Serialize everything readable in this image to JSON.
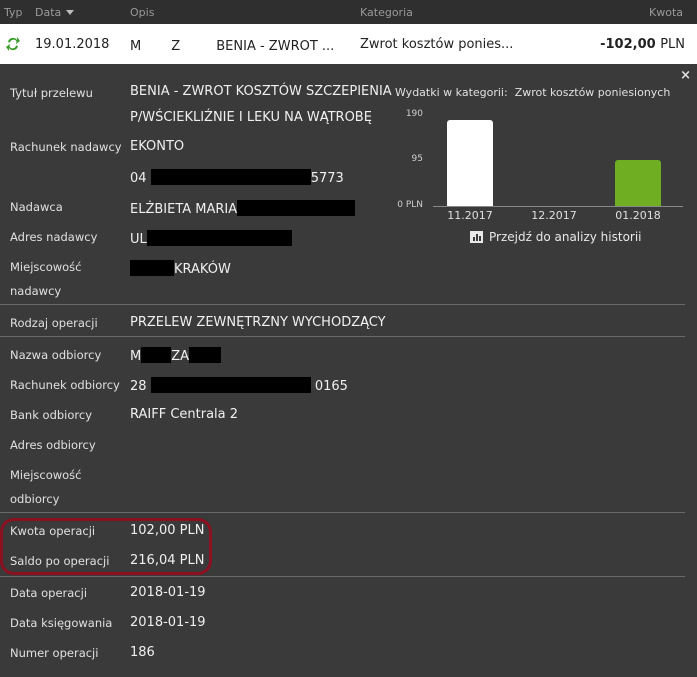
{
  "table": {
    "headers": {
      "typ": "Typ",
      "data": "Data",
      "opis": "Opis",
      "kategoria": "Kategoria",
      "kwota": "Kwota"
    },
    "row": {
      "date": "19.01.2018",
      "desc_prefix": "M",
      "desc_mid": "Z",
      "desc_suffix": "BENIA - ZWROT ...",
      "category": "Zwrot kosztów ponies...",
      "amount": "-102,00",
      "currency": "PLN"
    }
  },
  "details": {
    "close": "×",
    "tytul": {
      "label": "Tytuł przelewu",
      "line1": "BENIA - ZWROT KOSZTÓW SZCZEPIENIA",
      "line2": "P/WŚCIEKLIŹNIE I LEKU NA WĄTROBĘ"
    },
    "rachunek_nadawcy": {
      "label": "Rachunek nadawcy",
      "line1": "EKONTO",
      "prefix": "04",
      "suffix": "5773"
    },
    "nadawca": {
      "label": "Nadawca",
      "value": "ELŻBIETA MARIA"
    },
    "adres_nadawcy": {
      "label": "Adres nadawcy",
      "value": "UL"
    },
    "miejscowosc_nadawcy": {
      "label1": "Miejscowość",
      "label2": "nadawcy",
      "value": "KRAKÓW"
    },
    "rodzaj": {
      "label": "Rodzaj operacji",
      "value": "PRZELEW ZEWNĘTRZNY WYCHODZĄCY"
    },
    "nazwa_odbiorcy": {
      "label": "Nazwa odbiorcy",
      "prefix": "M",
      "mid": "ZA"
    },
    "rachunek_odbiorcy": {
      "label": "Rachunek odbiorcy",
      "prefix": "28",
      "suffix": "0165"
    },
    "bank_odbiorcy": {
      "label": "Bank odbiorcy",
      "value": "RAIFF Centrala 2"
    },
    "adres_odbiorcy": {
      "label": "Adres odbiorcy"
    },
    "miejscowosc_odbiorcy": {
      "label1": "Miejscowość",
      "label2": "odbiorcy"
    },
    "kwota": {
      "label": "Kwota operacji",
      "value": "102,00 PLN"
    },
    "saldo": {
      "label": "Saldo po operacji",
      "value": "216,04 PLN"
    },
    "data_operacji": {
      "label": "Data operacji",
      "value": "2018-01-19"
    },
    "data_ksiegowania": {
      "label": "Data księgowania",
      "value": "2018-01-19"
    },
    "numer": {
      "label": "Numer operacji",
      "value": "186"
    }
  },
  "chart_data": {
    "type": "bar",
    "title_prefix": "Wydatki w kategorii:",
    "title": "Zwrot kosztów poniesionych",
    "categories": [
      "11.2017",
      "12.2017",
      "01.2018"
    ],
    "values": [
      190,
      0,
      102
    ],
    "bar_colors": [
      "#ffffff",
      "#ffffff",
      "#6fae22"
    ],
    "yticks": [
      "190",
      "95",
      "0 PLN"
    ],
    "ylim": [
      0,
      190
    ]
  },
  "link": {
    "label": "Przejdź do analizy historii"
  },
  "colors": {
    "accent_green": "#6fae22",
    "highlight": "#8b1020"
  }
}
